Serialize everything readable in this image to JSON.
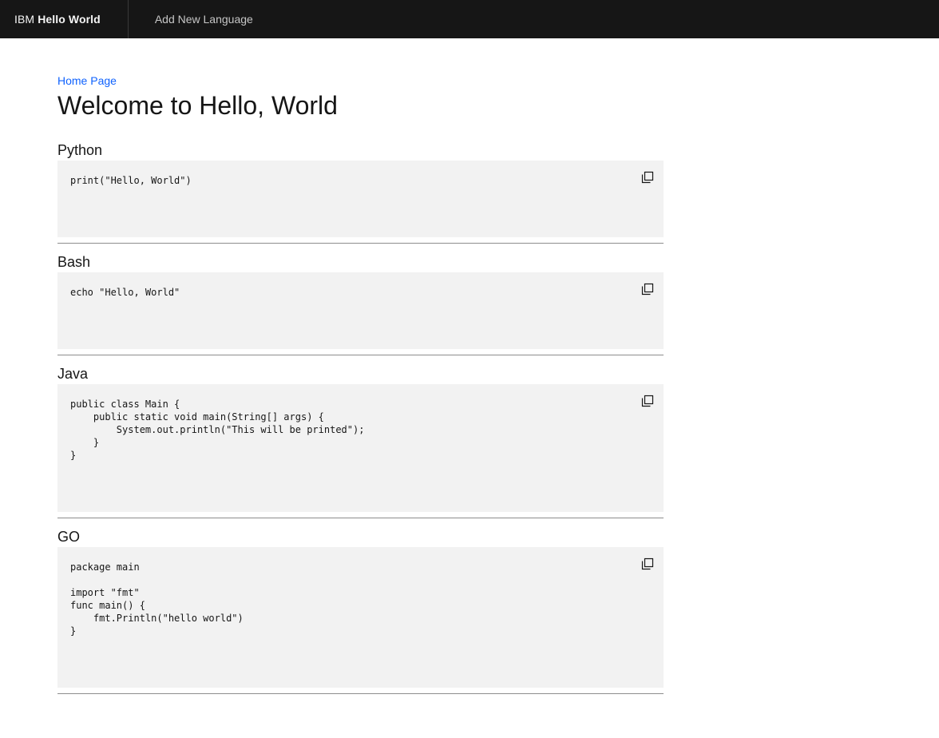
{
  "header": {
    "brand_prefix": "IBM",
    "brand_name": "Hello World",
    "nav_item": "Add New Language"
  },
  "breadcrumb": "Home Page",
  "page_title": "Welcome to Hello, World",
  "sections": [
    {
      "title": "Python",
      "code": "print(\"Hello, World\")"
    },
    {
      "title": "Bash",
      "code": "echo \"Hello, World\""
    },
    {
      "title": "Java",
      "code": "public class Main {\n    public static void main(String[] args) {\n        System.out.println(\"This will be printed\");\n    }\n}"
    },
    {
      "title": "GO",
      "code": "package main\n\nimport \"fmt\"\nfunc main() {\n    fmt.Println(\"hello world\")\n}"
    }
  ],
  "icons": {
    "copy": "copy-icon"
  },
  "colors": {
    "header_bg": "#161616",
    "code_bg": "#f2f2f2",
    "link": "#0f62fe",
    "divider": "#8d8d8d"
  }
}
